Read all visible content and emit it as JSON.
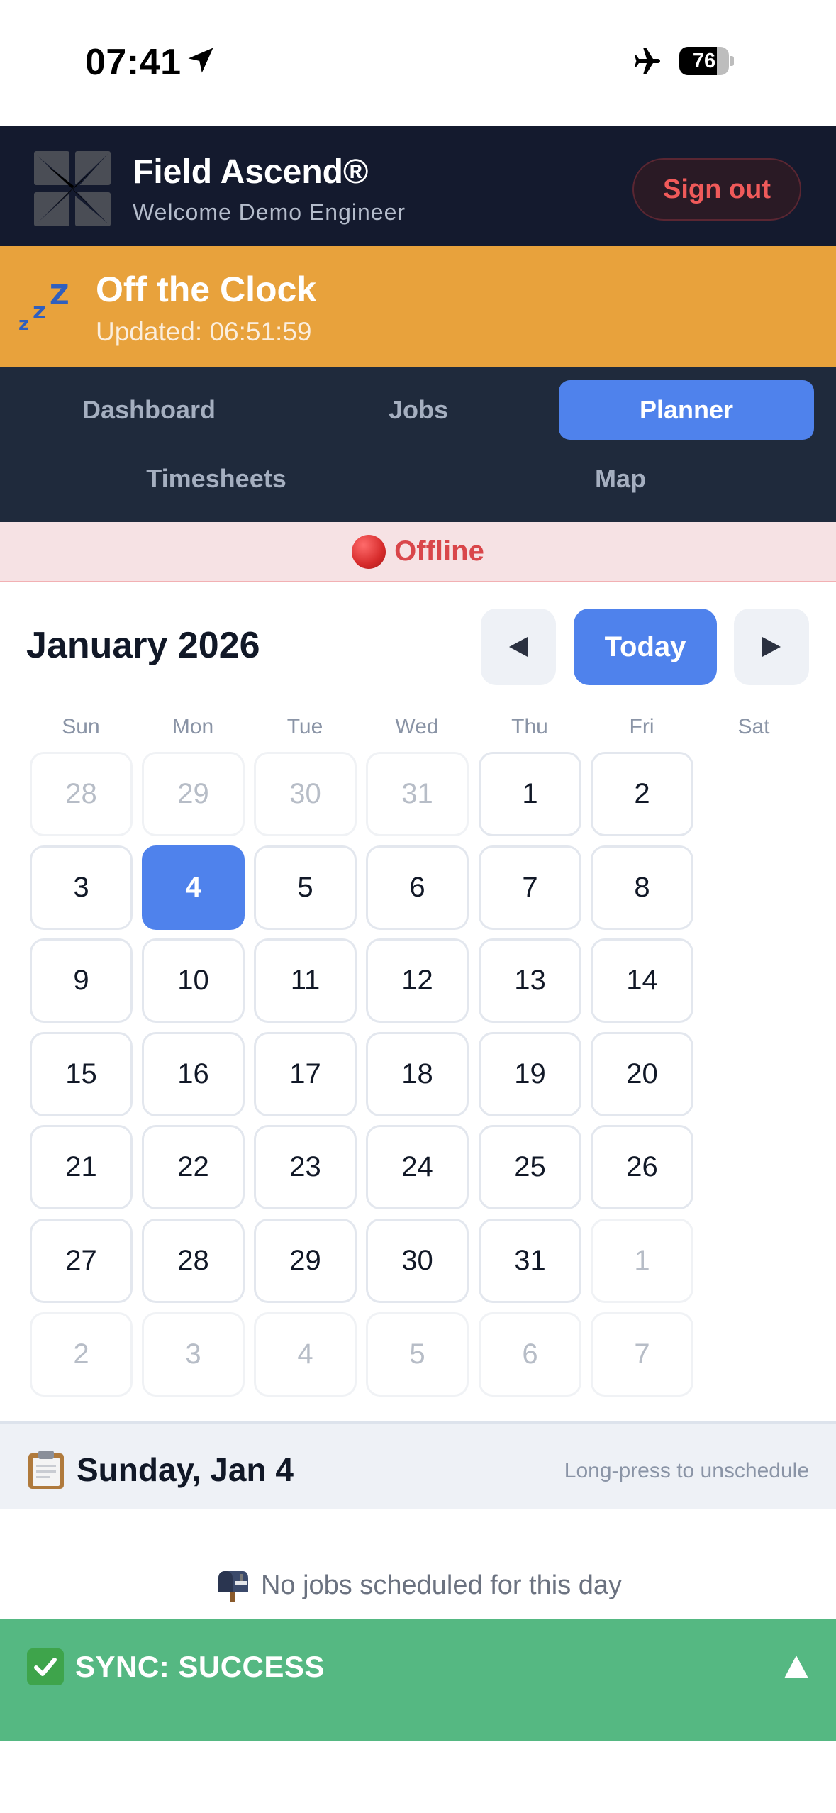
{
  "status_bar": {
    "time": "07:41",
    "battery": 76,
    "battery_label": "76"
  },
  "header": {
    "app_title": "Field Ascend®",
    "welcome": "Welcome Demo Engineer",
    "sign_out": "Sign out"
  },
  "clock_status": {
    "title": "Off the Clock",
    "updated": "Updated: 06:51:59",
    "color": "#e8a23c"
  },
  "nav": {
    "items": [
      {
        "label": "Dashboard",
        "active": false
      },
      {
        "label": "Jobs",
        "active": false
      },
      {
        "label": "Planner",
        "active": true
      },
      {
        "label": "Timesheets",
        "active": false
      },
      {
        "label": "Map",
        "active": false
      }
    ]
  },
  "connection": {
    "label": "Offline",
    "color": "#d9464a"
  },
  "calendar": {
    "month_label": "January 2026",
    "today_label": "Today",
    "weekdays": [
      "Sun",
      "Mon",
      "Tue",
      "Wed",
      "Thu",
      "Fri",
      "Sat"
    ],
    "weeks": [
      [
        {
          "d": "28",
          "other": true
        },
        {
          "d": "29",
          "other": true
        },
        {
          "d": "30",
          "other": true
        },
        {
          "d": "31",
          "other": true
        },
        {
          "d": "1"
        },
        {
          "d": "2"
        }
      ],
      [
        {
          "d": "3"
        },
        {
          "d": "4",
          "selected": true
        },
        {
          "d": "5"
        },
        {
          "d": "6"
        },
        {
          "d": "7"
        },
        {
          "d": "8"
        }
      ],
      [
        {
          "d": "9"
        },
        {
          "d": "10"
        },
        {
          "d": "11"
        },
        {
          "d": "12"
        },
        {
          "d": "13"
        },
        {
          "d": "14"
        }
      ],
      [
        {
          "d": "15"
        },
        {
          "d": "16"
        },
        {
          "d": "17"
        },
        {
          "d": "18"
        },
        {
          "d": "19"
        },
        {
          "d": "20"
        }
      ],
      [
        {
          "d": "21"
        },
        {
          "d": "22"
        },
        {
          "d": "23"
        },
        {
          "d": "24"
        },
        {
          "d": "25"
        },
        {
          "d": "26"
        }
      ],
      [
        {
          "d": "27"
        },
        {
          "d": "28"
        },
        {
          "d": "29"
        },
        {
          "d": "30"
        },
        {
          "d": "31"
        },
        {
          "d": "1",
          "other": true
        }
      ],
      [
        {
          "d": "2",
          "other": true
        },
        {
          "d": "3",
          "other": true
        },
        {
          "d": "4",
          "other": true
        },
        {
          "d": "5",
          "other": true
        },
        {
          "d": "6",
          "other": true
        },
        {
          "d": "7",
          "other": true
        }
      ]
    ]
  },
  "day_panel": {
    "title": "Sunday, Jan 4",
    "hint": "Long-press to unschedule",
    "empty_message": "No jobs scheduled for this day"
  },
  "sync": {
    "label": "SYNC: SUCCESS",
    "color": "#55b882"
  },
  "colors": {
    "accent": "#4f82ec",
    "header_bg": "#141a2e",
    "nav_bg": "#1f2a3c"
  }
}
